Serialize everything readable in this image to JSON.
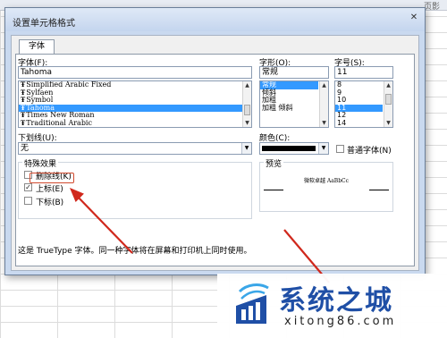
{
  "window": {
    "title": "设置单元格格式",
    "close_glyph": "✕",
    "corner_label": "页影"
  },
  "tabs": [
    {
      "label": "字体"
    }
  ],
  "font": {
    "label": "字体(F):",
    "value": "Tahoma",
    "options": [
      {
        "name": "Simplified Arabic Fixed",
        "selected": false
      },
      {
        "name": "Sylfaen",
        "selected": false
      },
      {
        "name": "Symbol",
        "selected": false
      },
      {
        "name": "Tahoma",
        "selected": true
      },
      {
        "name": "Times New Roman",
        "selected": false
      },
      {
        "name": "Traditional Arabic",
        "selected": false
      }
    ]
  },
  "style": {
    "label": "字形(O):",
    "value": "常规",
    "options": [
      {
        "name": "常规",
        "selected": true
      },
      {
        "name": "倾斜",
        "selected": false
      },
      {
        "name": "加粗",
        "selected": false
      },
      {
        "name": "加粗 倾斜",
        "selected": false
      }
    ]
  },
  "size": {
    "label": "字号(S):",
    "value": "11",
    "options": [
      {
        "name": "8",
        "selected": false
      },
      {
        "name": "9",
        "selected": false
      },
      {
        "name": "10",
        "selected": false
      },
      {
        "name": "11",
        "selected": true
      },
      {
        "name": "12",
        "selected": false
      },
      {
        "name": "14",
        "selected": false
      }
    ]
  },
  "underline": {
    "label": "下划线(U):",
    "value": "无"
  },
  "color": {
    "label": "颜色(C):",
    "value_color": "#000000"
  },
  "normal_font": {
    "label": "普通字体(N)",
    "checked": false
  },
  "effects": {
    "label": "特殊效果",
    "options": [
      {
        "label": "删除线(K)",
        "checked": false
      },
      {
        "label": "上标(E)",
        "checked": true
      },
      {
        "label": "下标(B)",
        "checked": false
      }
    ]
  },
  "preview": {
    "label": "预览",
    "sample": "微软卓越  AaBbCc"
  },
  "description": "这是 TrueType 字体。同一种字体将在屏幕和打印机上同时使用。",
  "watermark": {
    "name": "系统之城",
    "url": "xitong86.com"
  },
  "colors": {
    "arrow": "#d0281c",
    "selection": "#3399ff",
    "brand": "#1f4fa6"
  },
  "icons": {
    "font_type": "truetype-icon"
  }
}
